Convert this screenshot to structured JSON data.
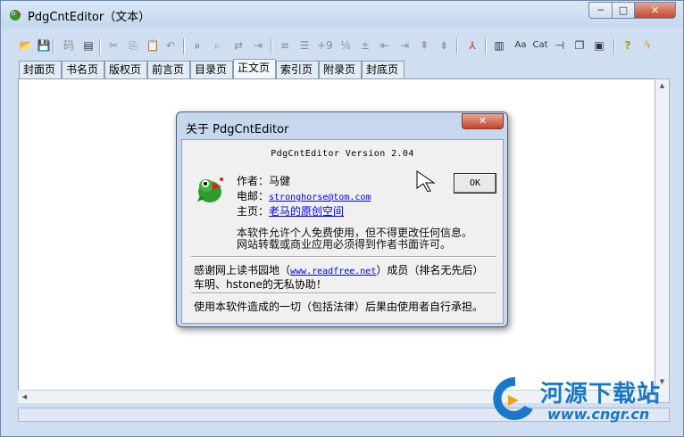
{
  "window": {
    "title": "PdgCntEditor（文本）",
    "min_glyph": "─",
    "max_glyph": "□",
    "close_glyph": "✕"
  },
  "toolbar": {
    "icons": [
      {
        "name": "open-folder-icon",
        "glyph": "📂",
        "dim": false
      },
      {
        "name": "save-icon",
        "glyph": "💾",
        "dim": false
      },
      {
        "name": "encoding-icon",
        "glyph": "码",
        "dim": true
      },
      {
        "name": "import-icon",
        "glyph": "▤",
        "dim": false
      },
      {
        "name": "cut-icon",
        "glyph": "✂",
        "dim": true
      },
      {
        "name": "copy-icon",
        "glyph": "⎘",
        "dim": true
      },
      {
        "name": "paste-icon",
        "glyph": "📋",
        "dim": false
      },
      {
        "name": "undo-icon",
        "glyph": "↶",
        "dim": true
      },
      {
        "name": "find-icon",
        "glyph": "⌕",
        "dim": false
      },
      {
        "name": "find-next-icon",
        "glyph": "⌕",
        "dim": true
      },
      {
        "name": "replace-icon",
        "glyph": "⇄",
        "dim": true
      },
      {
        "name": "goto-icon",
        "glyph": "⇥",
        "dim": true
      },
      {
        "name": "align-left-icon",
        "glyph": "≡",
        "dim": true
      },
      {
        "name": "align-list-icon",
        "glyph": "☰",
        "dim": true
      },
      {
        "name": "add-number-icon",
        "glyph": "+9",
        "dim": true
      },
      {
        "name": "page-number-icon",
        "glyph": "⅙",
        "dim": true
      },
      {
        "name": "insert-line-icon",
        "glyph": "±",
        "dim": true
      },
      {
        "name": "indent-icon",
        "glyph": "⇤",
        "dim": true
      },
      {
        "name": "outdent-icon",
        "glyph": "⇥",
        "dim": true
      },
      {
        "name": "level-up-icon",
        "glyph": "⇞",
        "dim": true
      },
      {
        "name": "level-down-icon",
        "glyph": "⇟",
        "dim": true
      },
      {
        "name": "pdf-icon",
        "glyph": "⅄",
        "dim": false
      },
      {
        "name": "columns-icon",
        "glyph": "▥",
        "dim": false
      },
      {
        "name": "font-icon",
        "glyph": "Aa",
        "dim": false
      },
      {
        "name": "cat-icon",
        "glyph": "Cat",
        "dim": false
      },
      {
        "name": "pin-icon",
        "glyph": "⊣",
        "dim": false
      },
      {
        "name": "window-icon",
        "glyph": "❐",
        "dim": false
      },
      {
        "name": "preview-icon",
        "glyph": "▣",
        "dim": false
      },
      {
        "name": "help-icon",
        "glyph": "?",
        "dim": false
      },
      {
        "name": "lightning-icon",
        "glyph": "ϟ",
        "dim": false
      }
    ]
  },
  "tabs": [
    {
      "label": "封面页",
      "active": false
    },
    {
      "label": "书名页",
      "active": false
    },
    {
      "label": "版权页",
      "active": false
    },
    {
      "label": "前言页",
      "active": false
    },
    {
      "label": "目录页",
      "active": false
    },
    {
      "label": "正文页",
      "active": true
    },
    {
      "label": "索引页",
      "active": false
    },
    {
      "label": "附录页",
      "active": false
    },
    {
      "label": "封底页",
      "active": false
    }
  ],
  "dialog": {
    "title": "关于 PdgCntEditor",
    "close_glyph": "✕",
    "version": "PdgCntEditor Version 2.04",
    "author_label": "作者：",
    "author": "马健",
    "email_label": "电邮：",
    "email": "stronghorse@tom.com",
    "homepage_label": "主页：",
    "homepage": "老马的原创空间",
    "ok_label": "OK",
    "notice_line1": "本软件允许个人免费使用，但不得更改任何信息。",
    "notice_line2": "网站转载或商业应用必须得到作者书面许可。",
    "thanks_prefix": "感谢网上读书园地（",
    "thanks_link": "www.readfree.net",
    "thanks_suffix": "）成员（排名无先后）",
    "thanks_line2": "车明、hstone的无私协助！",
    "disclaimer": "使用本软件造成的一切（包括法律）后果由使用者自行承担。"
  },
  "watermark": {
    "name": "河源下载站",
    "url": "www.cngr.cn"
  },
  "colors": {
    "link": "#0000ee",
    "close_red": "#c3432a",
    "watermark_blue": "#1a78c8"
  }
}
